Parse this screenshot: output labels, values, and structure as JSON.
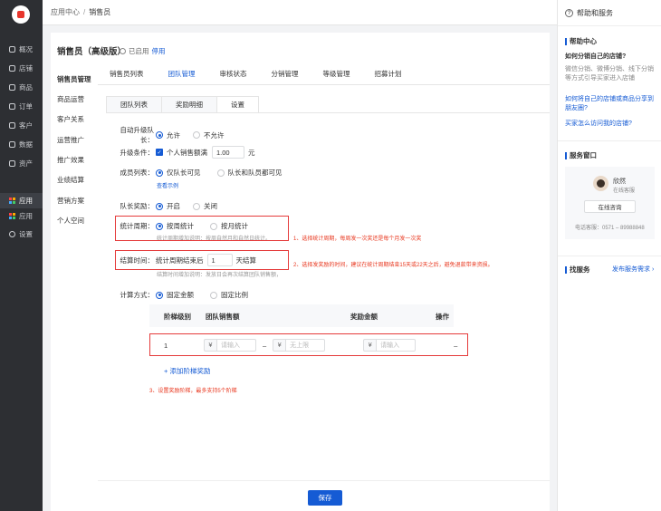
{
  "nav": {
    "items": [
      {
        "label": "概况"
      },
      {
        "label": "店铺"
      },
      {
        "label": "商品"
      },
      {
        "label": "订单"
      },
      {
        "label": "客户"
      },
      {
        "label": "数据"
      },
      {
        "label": "资产"
      },
      {
        "label": "应用"
      },
      {
        "label": "应用"
      },
      {
        "label": "设置"
      }
    ]
  },
  "header": {
    "crumb_root": "应用中心",
    "crumb_sep": "/",
    "crumb_current": "销售员"
  },
  "page": {
    "title": "销售员（高级版）",
    "status": "已启用",
    "disable_link": "停用"
  },
  "subnav": [
    "销售员管理",
    "商品运营",
    "客户关系",
    "运营推广",
    "推广效果",
    "业绩结算",
    "营销方案",
    "个人空间"
  ],
  "tabs": [
    "销售员列表",
    "团队管理",
    "审核状态",
    "分销管理",
    "等级管理",
    "招募计划"
  ],
  "subtabs": [
    "团队列表",
    "奖励明细",
    "设置"
  ],
  "form": {
    "auto_upgrade": {
      "label": "自动升级队长：",
      "opt1": "允许",
      "opt2": "不允许"
    },
    "upgrade_cond": {
      "label": "升级条件：",
      "check": "个人销售额满",
      "value": "1.00",
      "unit": "元"
    },
    "member_list": {
      "label": "成员列表：",
      "opt1": "仅队长可见",
      "opt2": "队长和队员都可见",
      "example": "查看示例"
    },
    "leader_reward": {
      "label": "队长奖励：",
      "opt1": "开启",
      "opt2": "关闭"
    },
    "period": {
      "label": "统计周期：",
      "opt1": "按周统计",
      "opt2": "按月统计",
      "hint": "统计周期增加说明：按周自然月和自然日统计。"
    },
    "settle": {
      "label": "结算时间：",
      "prefix": "统计周期结束后",
      "value": "1",
      "suffix": "天结算",
      "hint": "结算时间增加说明：发放日会再次结算团队销售额，扣除退款金额。建议发放时间在15日之后，降低退款带来的资损风险。"
    },
    "calc": {
      "label": "计算方式：",
      "opt1": "固定金额",
      "opt2": "固定比例"
    }
  },
  "table": {
    "headers": [
      "阶梯级别",
      "团队销售额",
      "奖励金额",
      "操作"
    ],
    "row": {
      "level": "1",
      "currency": "¥",
      "placeholder_input": "请输入",
      "dash": "–",
      "placeholder_max": "无上限",
      "op": "–"
    },
    "add_link": "+ 添加阶梯奖励"
  },
  "annotations": {
    "a1": "1、选择统计周期，每周发一次奖还是每个月发一次奖",
    "a2": "2、选择发奖励的时间，建议在统计周期结束15天或22天之后，避免退款带来资损。",
    "a3": "3、设置奖励阶梯，最多支持5个阶梯"
  },
  "footer": {
    "save": "保存"
  },
  "right_panel": {
    "title": "帮助和服务",
    "help_center": "帮助中心",
    "q1": "如何分销自己的店铺?",
    "q1_desc": "微信分销、微博分销、线下分销等方式引导买家进入店铺",
    "link1": "如何将自己的店铺或商品分享到朋友圈?",
    "link2": "买家怎么访问我的店铺?",
    "service_window": "服务窗口",
    "agent_name": "欣然",
    "agent_status": "在线客服",
    "consult": "在线咨询",
    "phone": "电话客服：0571 – 89988848",
    "find_service": "找服务",
    "post_need": "发布服务需求 ›"
  },
  "colors": {
    "accent": "#155bd4",
    "annotation": "#e53b3b",
    "nav_bg": "#2d2f33"
  }
}
